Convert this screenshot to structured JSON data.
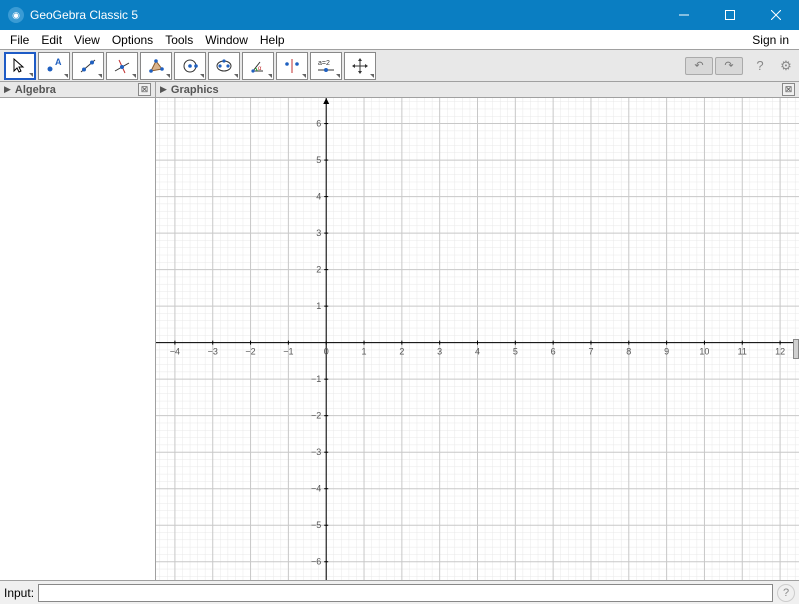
{
  "window": {
    "title": "GeoGebra Classic 5"
  },
  "menubar": {
    "file": "File",
    "edit": "Edit",
    "view": "View",
    "options": "Options",
    "tools": "Tools",
    "window": "Window",
    "help": "Help",
    "signin": "Sign in"
  },
  "toolbar": {
    "tools": [
      "move",
      "point",
      "line",
      "perpendicular",
      "polygon",
      "circle",
      "ellipse",
      "angle",
      "reflect",
      "slider",
      "move-view"
    ],
    "slider_label": "a=2"
  },
  "panels": {
    "algebra": "Algebra",
    "graphics": "Graphics"
  },
  "inputbar": {
    "label": "Input:",
    "value": "",
    "placeholder": ""
  },
  "chart_data": {
    "type": "scatter",
    "title": "",
    "xlabel": "",
    "ylabel": "",
    "series": [],
    "x_ticks": [
      -4,
      -3,
      -2,
      -1,
      0,
      1,
      2,
      3,
      4,
      5,
      6,
      7,
      8,
      9,
      10,
      11,
      12
    ],
    "y_ticks": [
      -6,
      -5,
      -4,
      -3,
      -2,
      -1,
      1,
      2,
      3,
      4,
      5,
      6
    ],
    "xlim": [
      -4.5,
      12.5
    ],
    "ylim": [
      -6.5,
      6.7
    ],
    "grid": true
  }
}
